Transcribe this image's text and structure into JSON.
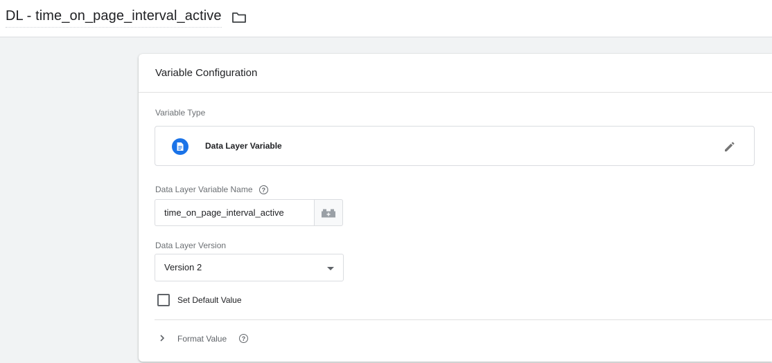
{
  "header": {
    "title": "DL - time_on_page_interval_active",
    "folder_icon": "folder-icon"
  },
  "card": {
    "title": "Variable Configuration",
    "variable_type": {
      "label": "Variable Type",
      "name": "Data Layer Variable",
      "icon": "document-icon",
      "edit_icon": "pencil-icon",
      "accent": "#1a73e8"
    },
    "dl_name": {
      "label": "Data Layer Variable Name",
      "help_icon": "help-icon",
      "value": "time_on_page_interval_active",
      "variable_picker_icon": "lego-brick-icon"
    },
    "dl_version": {
      "label": "Data Layer Version",
      "selected": "Version 2"
    },
    "default_value": {
      "label": "Set Default Value",
      "checked": false
    },
    "format_value": {
      "label": "Format Value",
      "expand_icon": "chevron-right-icon",
      "help_icon": "help-icon"
    }
  }
}
